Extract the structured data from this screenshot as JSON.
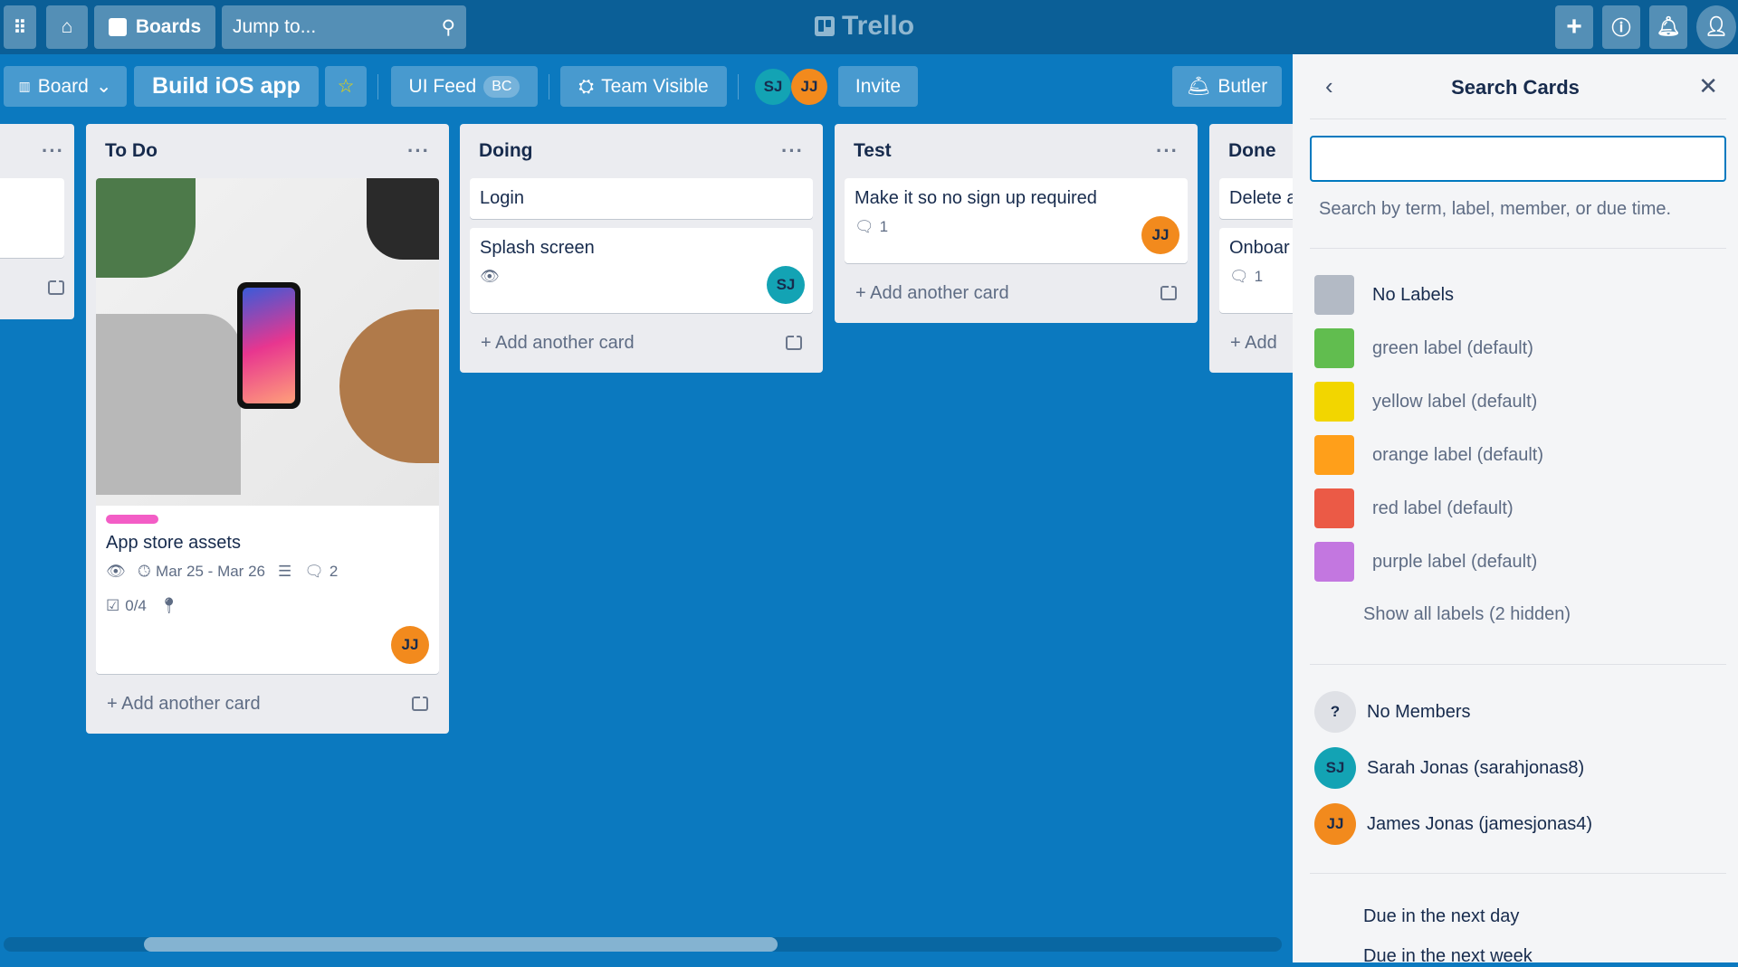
{
  "topbar": {
    "boards": "Boards",
    "search_placeholder": "Jump to...",
    "logo": "Trello"
  },
  "header": {
    "view": "Board",
    "board_title": "Build iOS app",
    "team": "UI Feed",
    "team_badge": "BC",
    "visibility": "Team Visible",
    "members": [
      "SJ",
      "JJ"
    ],
    "invite": "Invite",
    "butler": "Butler"
  },
  "lists": [
    {
      "title": "To Do",
      "cards": [
        {
          "title": "App store assets",
          "label_color": "#f35dc6",
          "dates": "Mar 25 - Mar 26",
          "comments": "2",
          "checklist": "0/4",
          "member": "JJ"
        }
      ],
      "add": "Add another card"
    },
    {
      "title": "Doing",
      "cards": [
        {
          "title": "Login"
        },
        {
          "title": "Splash screen",
          "member": "SJ"
        }
      ],
      "add": "Add another card"
    },
    {
      "title": "Test",
      "cards": [
        {
          "title": "Make it so no sign up required",
          "comments": "1",
          "member": "JJ"
        }
      ],
      "add": "Add another card"
    },
    {
      "title": "Done",
      "cards": [
        {
          "title": "Delete a"
        },
        {
          "title": "Onboar",
          "comments": "1"
        }
      ],
      "add": "Add"
    }
  ],
  "panel": {
    "title": "Search Cards",
    "input_value": "",
    "hint": "Search by term, label, member, or due time.",
    "labels": [
      {
        "name": "No Labels",
        "color": "#b3bac5"
      },
      {
        "name": "green label (default)",
        "color": "#61bd4f"
      },
      {
        "name": "yellow label (default)",
        "color": "#f2d600"
      },
      {
        "name": "orange label (default)",
        "color": "#ff9f1a"
      },
      {
        "name": "red label (default)",
        "color": "#eb5a46"
      },
      {
        "name": "purple label (default)",
        "color": "#c377e0"
      }
    ],
    "show_all": "Show all labels (2 hidden)",
    "members": [
      {
        "initials": "?",
        "name": "No Members"
      },
      {
        "initials": "SJ",
        "name": "Sarah Jonas (sarahjonas8)"
      },
      {
        "initials": "JJ",
        "name": "James Jonas (jamesjonas4)"
      }
    ],
    "due": [
      "Due in the next day",
      "Due in the next week"
    ]
  },
  "colors": {
    "board_bg": "#0b79bf",
    "topbar": "#0b5f97",
    "accent": "#0079bf"
  }
}
